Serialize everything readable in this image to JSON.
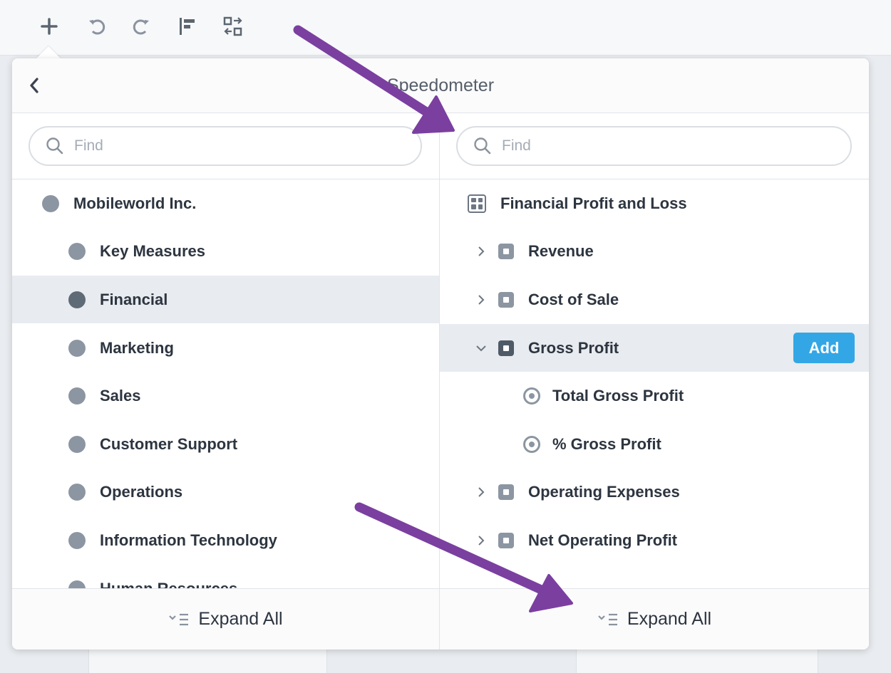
{
  "toolbar": {
    "icons": [
      "plus-icon",
      "undo-icon",
      "redo-icon",
      "align-icon",
      "swap-icon"
    ]
  },
  "popover": {
    "title": "Speedometer"
  },
  "left_pane": {
    "search_placeholder": "Find",
    "items": [
      {
        "label": "Mobileworld Inc.",
        "level": 0,
        "selected": false
      },
      {
        "label": "Key Measures",
        "level": 1,
        "selected": false
      },
      {
        "label": "Financial",
        "level": 1,
        "selected": true
      },
      {
        "label": "Marketing",
        "level": 1,
        "selected": false
      },
      {
        "label": "Sales",
        "level": 1,
        "selected": false
      },
      {
        "label": "Customer Support",
        "level": 1,
        "selected": false
      },
      {
        "label": "Operations",
        "level": 1,
        "selected": false
      },
      {
        "label": "Information Technology",
        "level": 1,
        "selected": false
      },
      {
        "label": "Human Resources",
        "level": 1,
        "selected": false
      }
    ],
    "expand_all_label": "Expand All"
  },
  "right_pane": {
    "search_placeholder": "Find",
    "items": [
      {
        "label": "Financial Profit and Loss",
        "icon": "scorecard-icon",
        "expanded": null,
        "selected": false
      },
      {
        "label": "Revenue",
        "icon": "group-icon",
        "expanded": false,
        "selected": false
      },
      {
        "label": "Cost of Sale",
        "icon": "group-icon",
        "expanded": false,
        "selected": false
      },
      {
        "label": "Gross Profit",
        "icon": "group-icon",
        "expanded": true,
        "selected": true
      },
      {
        "label": "Total Gross Profit",
        "icon": "target-icon",
        "expanded": null,
        "selected": false
      },
      {
        "label": "% Gross Profit",
        "icon": "target-icon",
        "expanded": null,
        "selected": false
      },
      {
        "label": "Operating Expenses",
        "icon": "group-icon",
        "expanded": false,
        "selected": false
      },
      {
        "label": "Net Operating Profit",
        "icon": "group-icon",
        "expanded": false,
        "selected": false
      }
    ],
    "add_label": "Add",
    "expand_all_label": "Expand All"
  },
  "colors": {
    "accent": "#33a7e6",
    "annotation_arrow": "#7b3fa0",
    "selected_row": "#e8ebef"
  }
}
